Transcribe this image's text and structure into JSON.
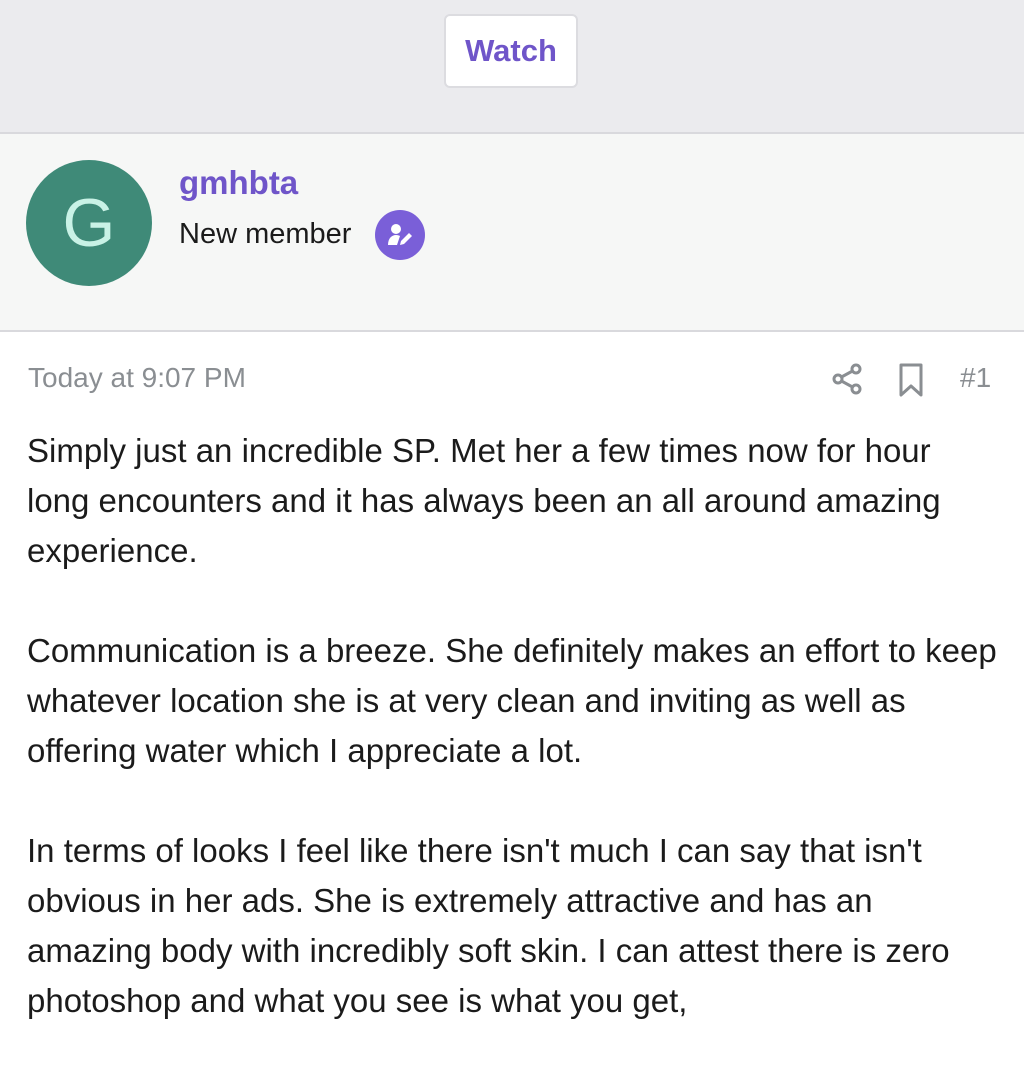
{
  "header": {
    "watch_label": "Watch"
  },
  "author": {
    "avatar_letter": "G",
    "username": "gmhbta",
    "title": "New member",
    "badge_icon": "user-edit-icon",
    "avatar_color": "#3f8a78",
    "username_color": "#6f55c9"
  },
  "post": {
    "timestamp": "Today at 9:07 PM",
    "number": "#1",
    "actions": [
      "share-icon",
      "bookmark-icon"
    ],
    "paragraphs": [
      "Simply just an incredible SP. Met her a few times now for hour long encounters and it has always been an all around amazing experience.",
      "Communication is a breeze. She definitely makes an effort to keep whatever location she is at very clean and inviting as well as offering water which I appreciate a lot.",
      "In terms of looks I feel like there isn't much I can say that isn't obvious in her ads. She is extremely attractive and has an amazing body with incredibly soft skin. I can attest there is zero photoshop and what you see is what you get,"
    ]
  }
}
